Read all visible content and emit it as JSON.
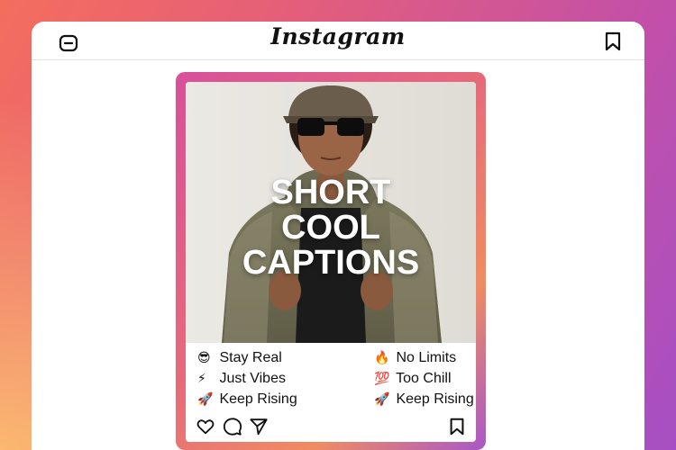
{
  "app": {
    "title": "Instagram",
    "icons": {
      "left": "minus-circle-icon",
      "right": "bookmark-icon"
    }
  },
  "post": {
    "overlay_lines": [
      "SHORT",
      "COOL",
      "CAPTIONS"
    ],
    "captions": [
      {
        "emoji": "😎",
        "text": "Stay Real"
      },
      {
        "emoji": "⚡",
        "text": "Just Vibes"
      },
      {
        "emoji": "🚀",
        "text": "Keep Rising"
      },
      {
        "emoji": "🔥",
        "text": "No Limits"
      },
      {
        "emoji": "💯",
        "text": "Too Chill"
      },
      {
        "emoji": "🚀",
        "text": "Keep Rising"
      }
    ],
    "actions": [
      "heart-icon",
      "comment-icon",
      "share-icon",
      "bookmark-icon"
    ]
  },
  "colors": {
    "gradient_start": "#f46e5e",
    "gradient_end": "#a64fc4",
    "frame_pink": "#d8509a",
    "frame_orange": "#f08c62"
  }
}
